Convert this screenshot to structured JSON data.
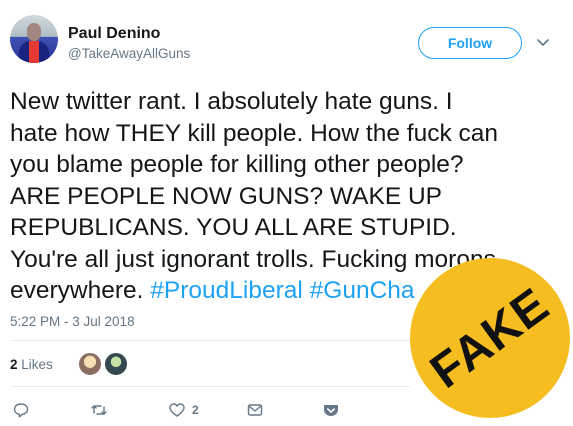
{
  "author": {
    "name": "Paul Denino",
    "handle": "@TakeAwayAllGuns"
  },
  "follow_label": "Follow",
  "tweet": {
    "lines": [
      "New twitter rant. I absolutely hate guns. I",
      "hate how THEY kill people. How the fuck can",
      "you blame people for killing other people?",
      "ARE PEOPLE NOW GUNS? WAKE UP",
      "REPUBLICANS. YOU ALL ARE STUPID.",
      "You're all just ignorant trolls. Fucking morons"
    ],
    "last_line_text": "everywhere.",
    "hashtag_1": "#ProudLiberal",
    "hashtag_2": "#GunCha"
  },
  "timestamp": "5:22 PM - 3 Jul 2018",
  "likes": {
    "count": "2",
    "label": "Likes"
  },
  "actions": {
    "like_count": "2"
  },
  "stamp": {
    "text": "FAKE",
    "color": "#f5bd1f"
  },
  "colors": {
    "accent": "#1da1f2",
    "muted": "#657786"
  }
}
